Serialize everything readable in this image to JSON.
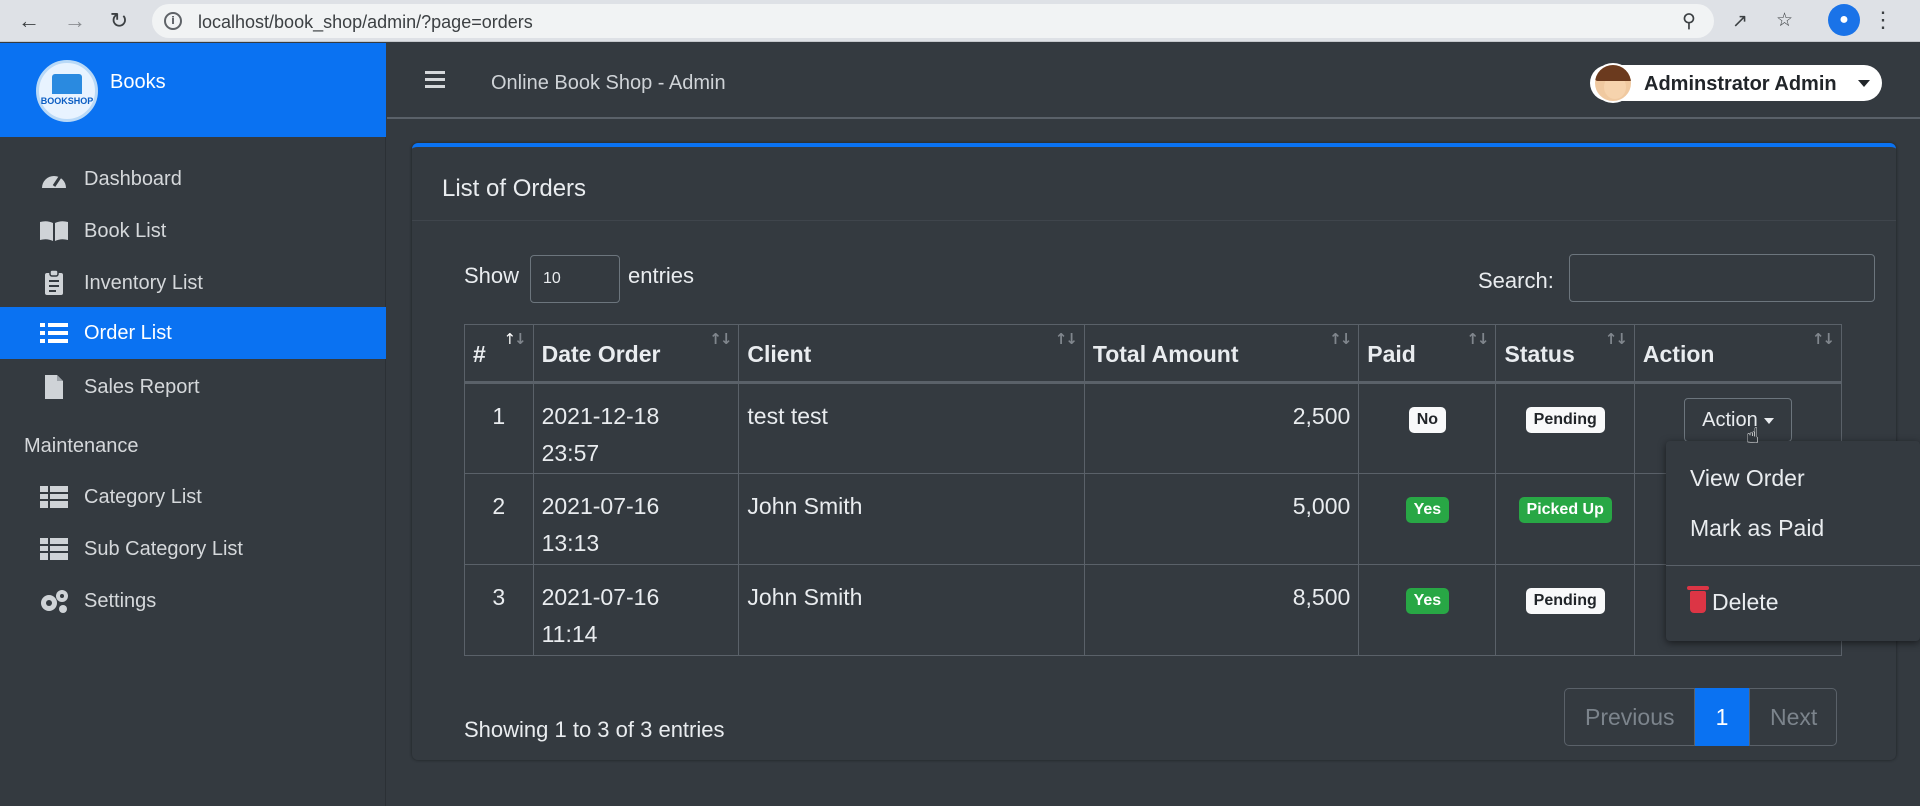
{
  "browser": {
    "url": "localhost/book_shop/admin/?page=orders"
  },
  "brand": {
    "name": "Books",
    "logo_text": "BOOKSHOP"
  },
  "sidebar": {
    "items": [
      {
        "label": "Dashboard",
        "icon": "gauge-icon"
      },
      {
        "label": "Book List",
        "icon": "book-icon"
      },
      {
        "label": "Inventory List",
        "icon": "clipboard-icon"
      },
      {
        "label": "Order List",
        "icon": "list-icon",
        "active": true
      },
      {
        "label": "Sales Report",
        "icon": "file-icon"
      }
    ],
    "maintenance_header": "Maintenance",
    "maintenance_items": [
      {
        "label": "Category List",
        "icon": "table-icon"
      },
      {
        "label": "Sub Category List",
        "icon": "table-icon"
      },
      {
        "label": "Settings",
        "icon": "gears-icon"
      }
    ]
  },
  "topbar": {
    "title": "Online Book Shop - Admin",
    "user_name": "Adminstrator Admin"
  },
  "card": {
    "title": "List of Orders"
  },
  "table_controls": {
    "show_label": "Show",
    "length_value": "10",
    "entries_label": "entries",
    "search_label": "Search:",
    "search_value": ""
  },
  "orders_table": {
    "columns": [
      "#",
      "Date Order",
      "Client",
      "Total Amount",
      "Paid",
      "Status",
      "Action"
    ],
    "rows": [
      {
        "num": "1",
        "date": "2021-12-18",
        "time": "23:57",
        "client": "test test",
        "amount": "2,500",
        "paid": "No",
        "status": "Pending",
        "action": "Action"
      },
      {
        "num": "2",
        "date": "2021-07-16",
        "time": "13:13",
        "client": "John Smith",
        "amount": "5,000",
        "paid": "Yes",
        "status": "Picked Up"
      },
      {
        "num": "3",
        "date": "2021-07-16",
        "time": "11:14",
        "client": "John Smith",
        "amount": "8,500",
        "paid": "Yes",
        "status": "Pending"
      }
    ]
  },
  "action_dropdown": {
    "items": [
      "View Order",
      "Mark as Paid"
    ],
    "delete_label": "Delete"
  },
  "pagination": {
    "info": "Showing 1 to 3 of 3 entries",
    "previous": "Previous",
    "current": "1",
    "next": "Next"
  },
  "colors": {
    "primary": "#0a72f2",
    "background": "#343a40",
    "success": "#28a745",
    "danger": "#dc3545"
  }
}
